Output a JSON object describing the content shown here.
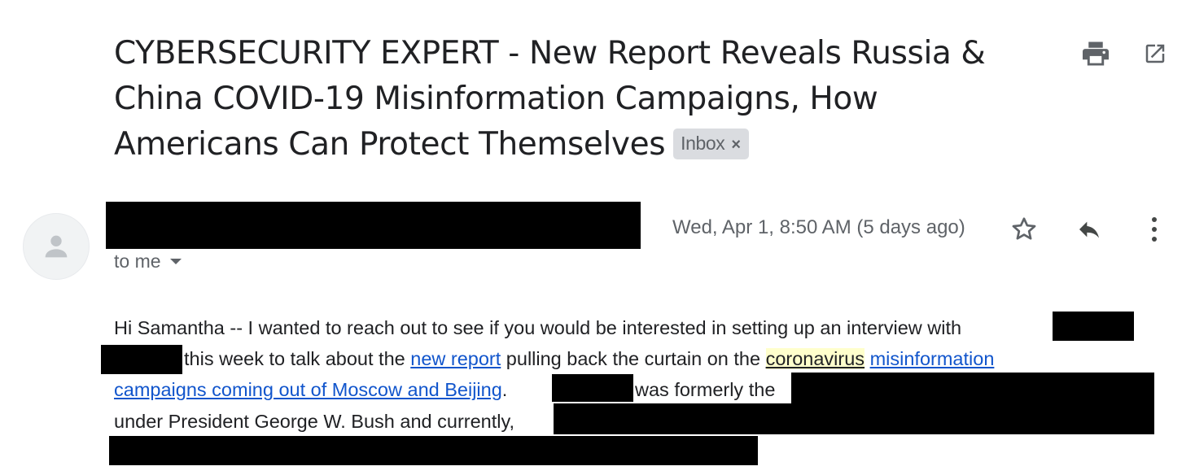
{
  "subject": {
    "lines": [
      "CYBERSECURITY EXPERT - New Report Reveals Russia &",
      "China COVID-19 Misinformation Campaigns, How",
      "Americans Can Protect Themselves"
    ],
    "label": "Inbox",
    "label_close": "×"
  },
  "toolbar": {
    "print_icon": "print-icon",
    "open_new_window_icon": "open-in-new-window-icon"
  },
  "message": {
    "avatar_icon": "person-icon",
    "date": "Wed, Apr 1, 8:50 AM (5 days ago)",
    "recipient": "to me",
    "actions": {
      "star_icon": "star-icon",
      "reply_icon": "reply-icon",
      "more_icon": "more-vert-icon"
    },
    "body": {
      "line1": "Hi Samantha -- I wanted to reach out to see if you would be interested in setting up an interview with",
      "line2_before": "this week to talk about the ",
      "link_new_report": "new report",
      "line2_mid": " pulling back the curtain on the ",
      "highlight_coronavirus": "coronavirus",
      "link_misinformation": "misinformation",
      "link_line3": "campaigns coming out of Moscow and Beijing",
      "line3_period": ".",
      "line3_after": "was formerly the",
      "line4": "under President George W. Bush and currently,"
    }
  },
  "colors": {
    "link": "#1155cc",
    "highlight": "#ffffcc",
    "redaction": "#000000",
    "muted": "#5f6368"
  }
}
